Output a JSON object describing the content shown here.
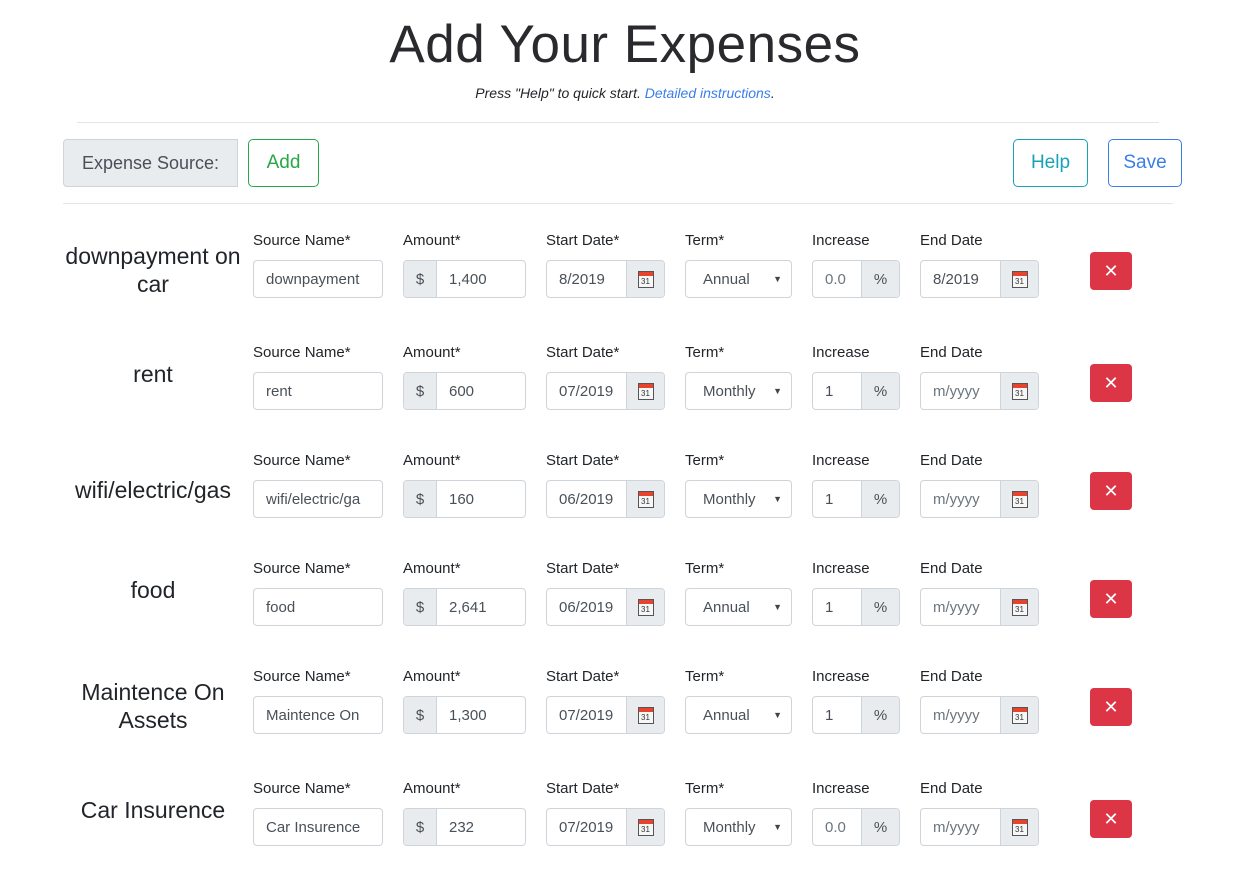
{
  "header": {
    "title": "Add Your Expenses",
    "subtitle_text": "Press \"Help\" to quick start. ",
    "subtitle_link": "Detailed instructions",
    "subtitle_end": "."
  },
  "toolbar": {
    "source_label": "Expense Source:",
    "add_label": "Add",
    "help_label": "Help",
    "save_label": "Save"
  },
  "field_labels": {
    "source_name": "Source Name*",
    "amount": "Amount*",
    "start_date": "Start Date*",
    "term": "Term*",
    "increase": "Increase",
    "end_date": "End Date"
  },
  "symbols": {
    "currency": "$",
    "percent": "%",
    "calendar_day": "31",
    "delete": "✕",
    "dropdown": "▼"
  },
  "placeholders": {
    "end_date": "m/yyyy"
  },
  "colors": {
    "add": "#28a745",
    "help": "#17a2b8",
    "save": "#3a7ee8",
    "delete": "#dc3545"
  },
  "expenses": [
    {
      "display_name": "downpayment on car",
      "source_name": "downpayment",
      "amount": "1,400",
      "start_date": "8/2019",
      "term": "Annual",
      "increase": "0.0",
      "increase_is_placeholder": true,
      "end_date": "8/2019"
    },
    {
      "display_name": "rent",
      "source_name": "rent",
      "amount": "600",
      "start_date": "07/2019",
      "term": "Monthly",
      "increase": "1",
      "end_date": ""
    },
    {
      "display_name": "wifi/electric/gas",
      "source_name": "wifi/electric/ga",
      "amount": "160",
      "start_date": "06/2019",
      "term": "Monthly",
      "increase": "1",
      "end_date": ""
    },
    {
      "display_name": "food",
      "source_name": "food",
      "amount": "2,641",
      "start_date": "06/2019",
      "term": "Annual",
      "increase": "1",
      "end_date": ""
    },
    {
      "display_name": "Maintence On Assets",
      "source_name": "Maintence On",
      "amount": "1,300",
      "start_date": "07/2019",
      "term": "Annual",
      "increase": "1",
      "end_date": ""
    },
    {
      "display_name": "Car Insurence",
      "source_name": "Car Insurence",
      "amount": "232",
      "start_date": "07/2019",
      "term": "Monthly",
      "increase": "0.0",
      "increase_is_placeholder": true,
      "end_date": ""
    }
  ]
}
